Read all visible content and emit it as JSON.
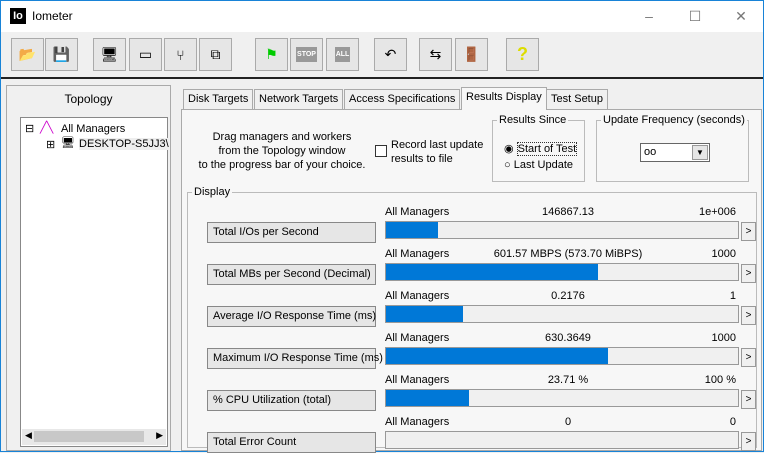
{
  "window": {
    "title": "Iometer",
    "logo": "Io",
    "minimize": "–",
    "maximize": "☐",
    "close": "✕"
  },
  "toolbar": [
    {
      "name": "open-icon",
      "glyph": "📂"
    },
    {
      "name": "save-icon",
      "glyph": "💾"
    },
    {
      "name": "new-manager-icon",
      "glyph": "🖥"
    },
    {
      "name": "new-disk-worker-icon",
      "glyph": "▭"
    },
    {
      "name": "new-network-worker-icon",
      "glyph": "⑂"
    },
    {
      "name": "duplicate-worker-icon",
      "glyph": "⧉"
    },
    {
      "name": "start-flag-icon",
      "glyph": "⚑"
    },
    {
      "name": "stop-icon",
      "glyph": "STOP"
    },
    {
      "name": "stop-all-icon",
      "glyph": "ALL"
    },
    {
      "name": "reset-workers-icon",
      "glyph": "↶"
    },
    {
      "name": "disconnect-icon",
      "glyph": "⇆"
    },
    {
      "name": "exit-icon",
      "glyph": "🚪"
    },
    {
      "name": "help-icon",
      "glyph": "?"
    }
  ],
  "topology": {
    "title": "Topology",
    "root": "All Managers",
    "child": "DESKTOP-S5JJ3\\"
  },
  "tabs": [
    "Disk Targets",
    "Network Targets",
    "Access Specifications",
    "Results Display",
    "Test Setup"
  ],
  "instructions": [
    "Drag managers and workers",
    "from the Topology window",
    "to the progress bar of your choice."
  ],
  "record": {
    "label1": "Record last update",
    "label2": "results to file",
    "checked": false
  },
  "results_since": {
    "title": "Results Since",
    "options": [
      "Start of Test",
      "Last Update"
    ],
    "selected": 0
  },
  "update_frequency": {
    "title": "Update Frequency (seconds)",
    "value": "oo"
  },
  "display": {
    "title": "Display",
    "rows": [
      {
        "button": "Total I/Os per Second",
        "source": "All Managers",
        "value": "146867.13",
        "max": "1e+006",
        "fraction": 0.147
      },
      {
        "button": "Total MBs per Second (Decimal)",
        "source": "All Managers",
        "value": "601.57 MBPS (573.70 MiBPS)",
        "max": "1000",
        "fraction": 0.6016
      },
      {
        "button": "Average I/O Response Time (ms)",
        "source": "All Managers",
        "value": "0.2176",
        "max": "1",
        "fraction": 0.2176
      },
      {
        "button": "Maximum I/O Response Time (ms)",
        "source": "All Managers",
        "value": "630.3649",
        "max": "1000",
        "fraction": 0.6304
      },
      {
        "button": "% CPU Utilization (total)",
        "source": "All Managers",
        "value": "23.71 %",
        "max": "100 %",
        "fraction": 0.2371
      },
      {
        "button": "Total Error Count",
        "source": "All Managers",
        "value": "0",
        "max": "0",
        "fraction": 0
      }
    ],
    "arrow": ">"
  }
}
